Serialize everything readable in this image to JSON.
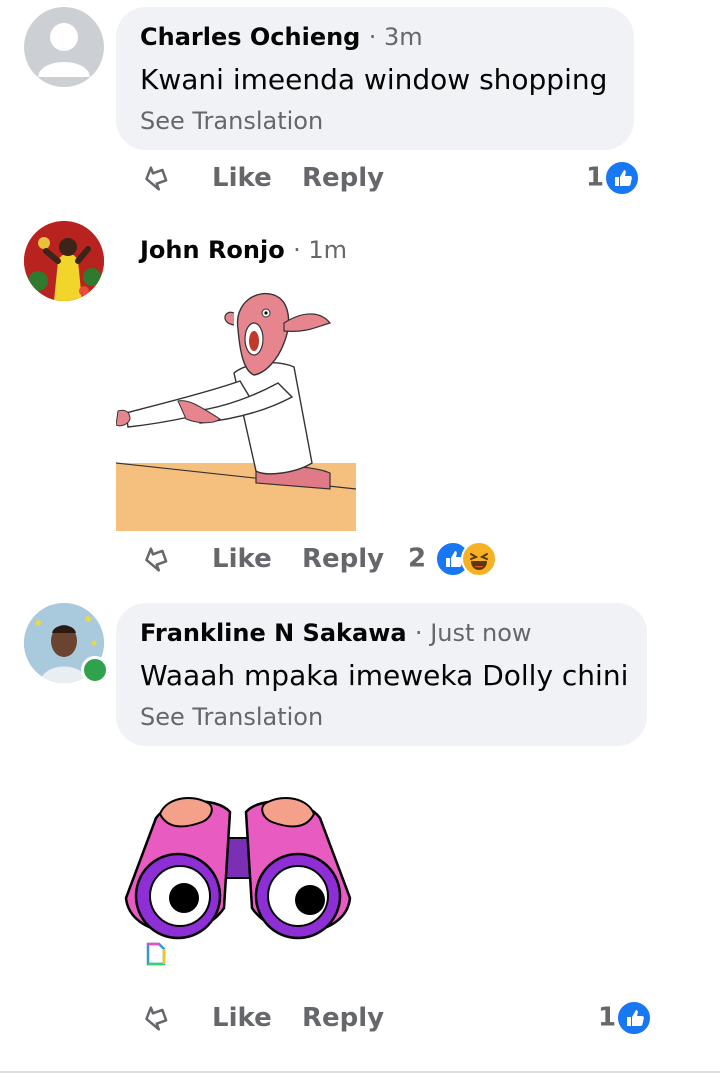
{
  "comments": [
    {
      "author": "Charles Ochieng",
      "time": "3m",
      "text": "Kwani imeenda window shopping",
      "see_translation": "See Translation",
      "like_label": "Like",
      "reply_label": "Reply",
      "reaction_count": "1"
    },
    {
      "author": "John Ronjo",
      "time": "1m",
      "like_label": "Like",
      "reply_label": "Reply",
      "reaction_count": "2"
    },
    {
      "author": "Frankline N Sakawa",
      "time": "Just now",
      "text": "Waaah mpaka imeweka Dolly chini",
      "see_translation": "See Translation",
      "like_label": "Like",
      "reply_label": "Reply",
      "reaction_count": "1"
    }
  ],
  "separator": "·",
  "colors": {
    "bubble": "#f0f2f5",
    "secondary_text": "#65676b",
    "like_blue": "#1877f2",
    "online_green": "#31a24c"
  }
}
